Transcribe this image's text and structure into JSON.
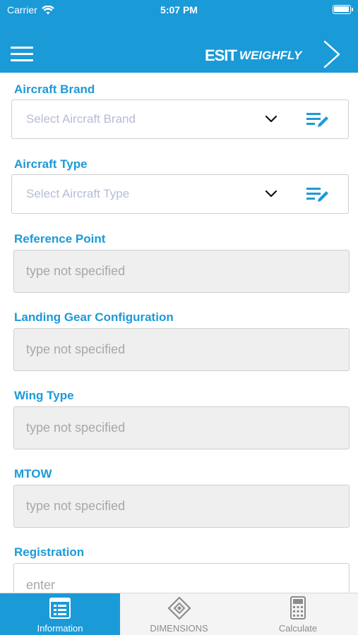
{
  "status": {
    "carrier": "Carrier",
    "time": "5:07 PM",
    "battery_level": 1.0
  },
  "nav": {
    "menu_icon": "hamburger-menu-icon",
    "brand_esit": "ESIT",
    "brand_weighfly": "WEIGHFLY",
    "next_icon": "chevron-right-icon",
    "color": "#1b9ad8"
  },
  "form": {
    "aircraft_brand": {
      "label": "Aircraft Brand",
      "placeholder": "Select Aircraft Brand"
    },
    "aircraft_type": {
      "label": "Aircraft Type",
      "placeholder": "Select Aircraft Type"
    },
    "reference_point": {
      "label": "Reference Point",
      "value": "type not specified"
    },
    "landing_gear": {
      "label": "Landing  Gear Configuration",
      "value": "type not specified"
    },
    "wing_type": {
      "label": "Wing Type",
      "value": "type not specified"
    },
    "mtow": {
      "label": "MTOW",
      "value": "type not specified"
    },
    "registration": {
      "label": "Registration",
      "placeholder": "enter"
    }
  },
  "tabs": [
    {
      "label": "Information",
      "icon": "information-form-icon",
      "active": true
    },
    {
      "label": "DIMENSIONS",
      "icon": "dimensions-diamond-icon",
      "active": false
    },
    {
      "label": "Calculate",
      "icon": "calculator-icon",
      "active": false
    }
  ],
  "colors": {
    "accent": "#1b9ad8",
    "placeholder_select": "#b7bbd8",
    "placeholder_field": "#a8a8a8",
    "readonly_bg": "#efefef"
  }
}
